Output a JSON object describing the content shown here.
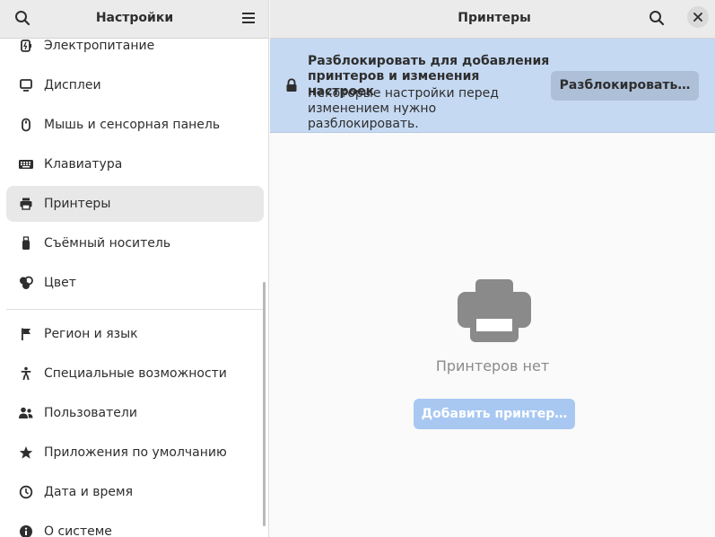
{
  "sidebar": {
    "title": "Настройки",
    "search_icon": "search-icon",
    "menu_icon": "hamburger-menu-icon",
    "items": [
      {
        "label": "Электропитание",
        "icon": "power-icon"
      },
      {
        "label": "Дисплеи",
        "icon": "display-icon"
      },
      {
        "label": "Мышь и сенсорная панель",
        "icon": "mouse-icon"
      },
      {
        "label": "Клавиатура",
        "icon": "keyboard-icon"
      },
      {
        "label": "Принтеры",
        "icon": "printer-icon",
        "active": true
      },
      {
        "label": "Съёмный носитель",
        "icon": "usb-icon"
      },
      {
        "label": "Цвет",
        "icon": "color-icon"
      },
      {
        "label": "Регион и язык",
        "icon": "flag-icon"
      },
      {
        "label": "Специальные возможности",
        "icon": "accessibility-icon"
      },
      {
        "label": "Пользователи",
        "icon": "users-icon"
      },
      {
        "label": "Приложения по умолчанию",
        "icon": "star-icon"
      },
      {
        "label": "Дата и время",
        "icon": "clock-icon"
      },
      {
        "label": "О системе",
        "icon": "info-icon"
      }
    ]
  },
  "main": {
    "title": "Принтеры",
    "search_icon": "search-icon",
    "close_icon": "close-icon",
    "banner": {
      "heading": "Разблокировать для добавления принтеров и изменения настроек",
      "description": "Некоторые настройки перед изменением нужно разблокировать.",
      "button": "Разблокировать…",
      "icon": "lock-icon"
    },
    "empty": {
      "icon": "printer-icon",
      "label": "Принтеров нет",
      "button": "Добавить принтер…"
    }
  },
  "colors": {
    "banner_bg": "#c5d9f2",
    "unlock_button_bg": "#adc0d8",
    "add_button_bg": "#a8c8f2",
    "active_item_bg": "#e8e8e8",
    "header_bg": "#ebebeb"
  }
}
